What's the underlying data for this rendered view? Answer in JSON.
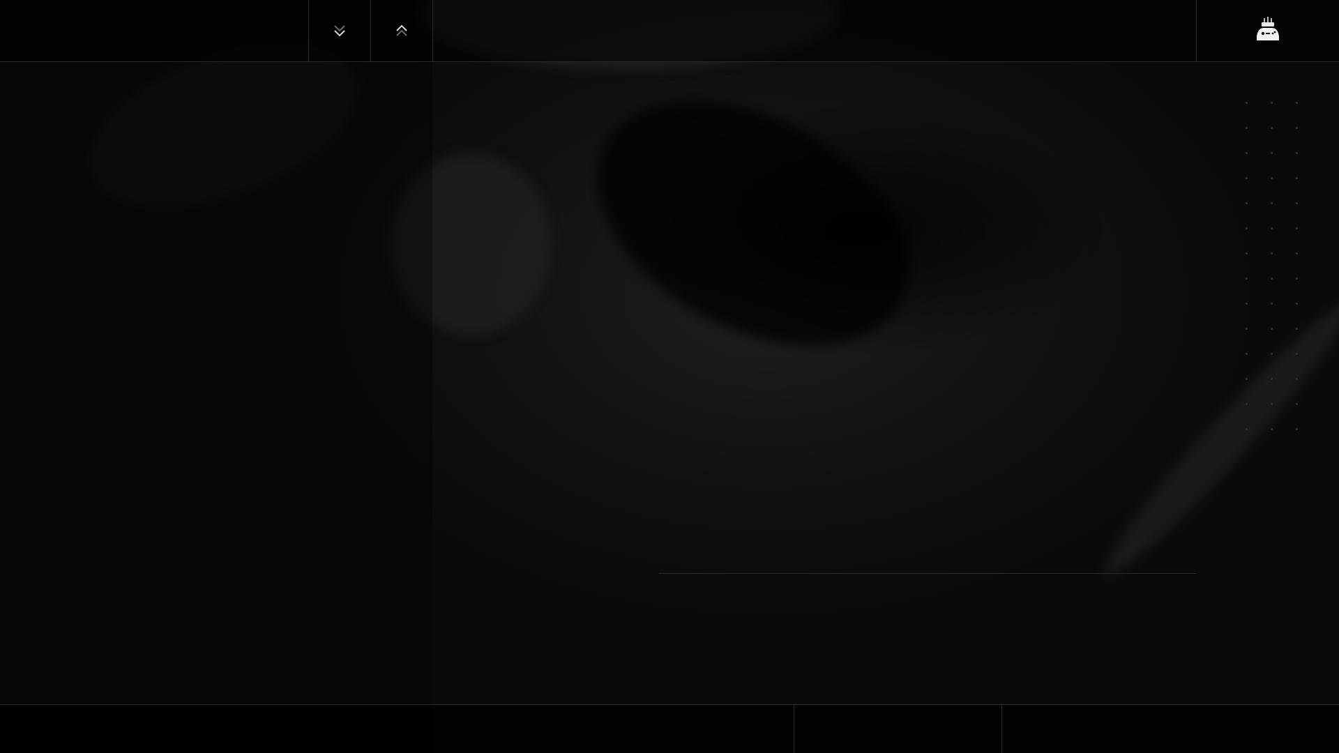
{
  "header": {
    "scroll_down_icon": "chevron-double-down-icon",
    "scroll_up_icon": "chevron-double-up-icon",
    "logo_icon": "gamepad-cake-logo-icon"
  },
  "colors": {
    "background": "#060606",
    "divider": "#2a2a2a",
    "icon_light": "#d8d8d8",
    "dot": "#333333"
  }
}
